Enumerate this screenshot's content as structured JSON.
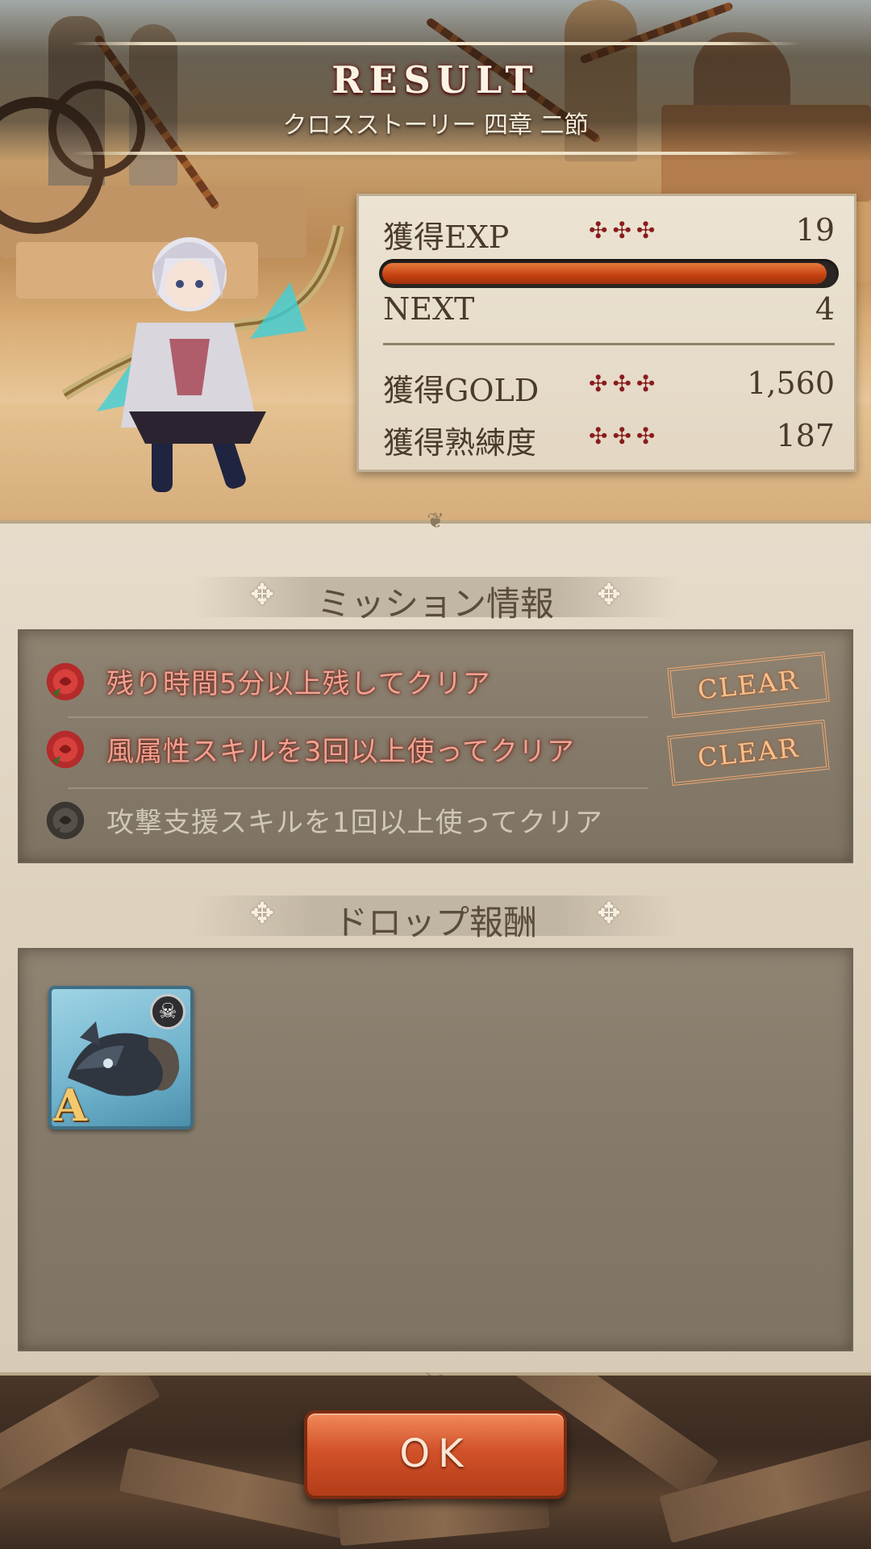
{
  "header": {
    "title": "RESULT",
    "subtitle": "クロスストーリー 四章 二節"
  },
  "stats": {
    "exp_label": "獲得EXP",
    "exp_value": "19",
    "exp_progress": 0.98,
    "next_label": "NEXT",
    "next_value": "4",
    "gold_label": "獲得GOLD",
    "gold_value": "1,560",
    "mastery_label": "獲得熟練度",
    "mastery_value": "187",
    "ornament": "✣✣✣"
  },
  "missions": {
    "title": "ミッション情報",
    "items": [
      {
        "text": "残り時間5分以上残してクリア",
        "cleared": true,
        "badge": "CLEAR"
      },
      {
        "text": "風属性スキルを3回以上使ってクリア",
        "cleared": true,
        "badge": "CLEAR"
      },
      {
        "text": "攻撃支援スキルを1回以上使ってクリア",
        "cleared": false,
        "badge": ""
      }
    ]
  },
  "drops": {
    "title": "ドロップ報酬",
    "items": [
      {
        "icon": "beast-weapon-icon",
        "rank": "A",
        "badge_icon": "skull-icon"
      }
    ]
  },
  "ok_button": {
    "label": "OK"
  },
  "colors": {
    "accent": "#c84413",
    "mission_done": "#f4a090",
    "mission_todo": "#cfc8ba",
    "clear_stamp": "#f8c08a"
  }
}
